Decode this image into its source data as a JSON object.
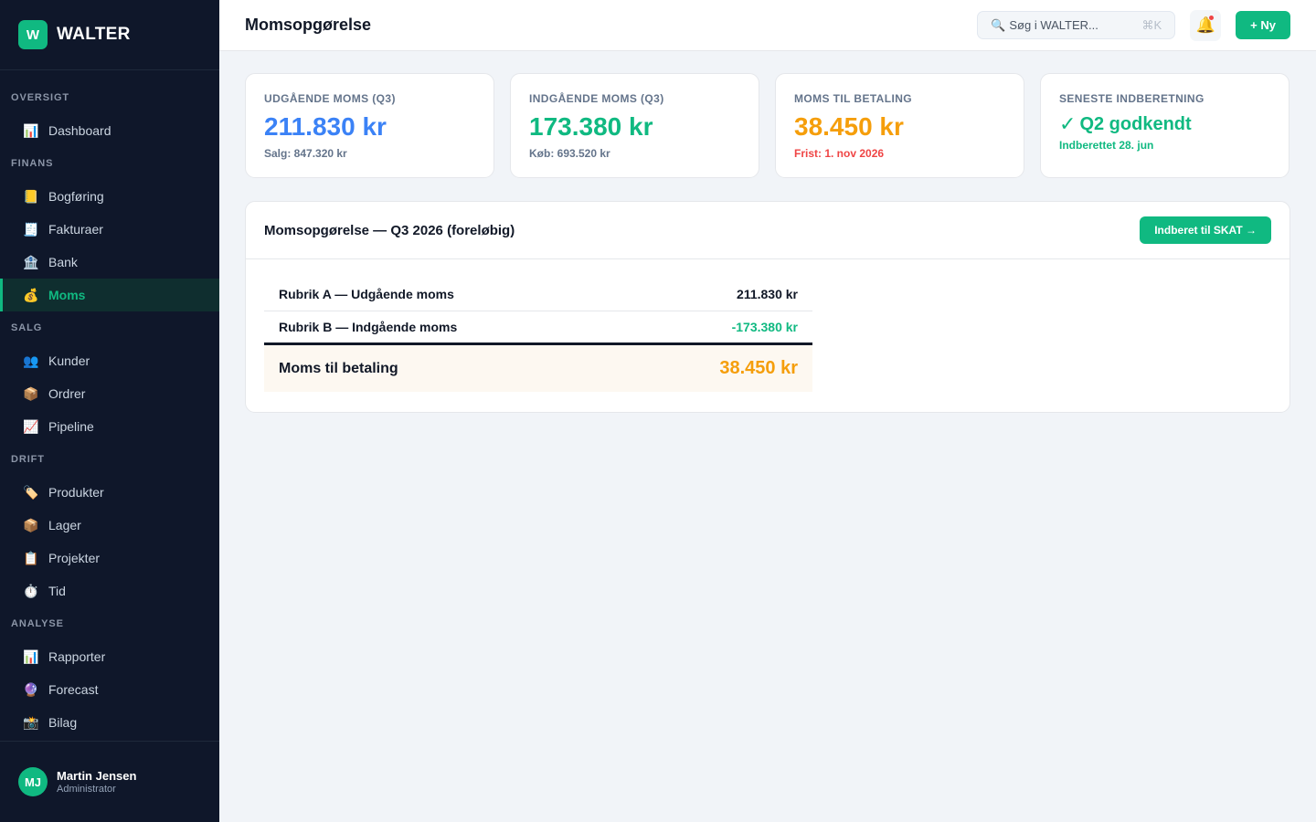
{
  "brand": {
    "logo_letter": "W",
    "name": "WALTER"
  },
  "sidebar": {
    "sections": [
      {
        "title": "OVERSIGT",
        "items": [
          {
            "label": "Dashboard",
            "icon": "📊",
            "icon_name": "chart-icon"
          }
        ]
      },
      {
        "title": "FINANS",
        "items": [
          {
            "label": "Bogføring",
            "icon": "📒",
            "icon_name": "ledger-icon"
          },
          {
            "label": "Fakturaer",
            "icon": "🧾",
            "icon_name": "receipt-icon"
          },
          {
            "label": "Bank",
            "icon": "🏦",
            "icon_name": "bank-icon"
          },
          {
            "label": "Moms",
            "icon": "💰",
            "icon_name": "money-bag-icon",
            "active": true
          }
        ]
      },
      {
        "title": "SALG",
        "items": [
          {
            "label": "Kunder",
            "icon": "👥",
            "icon_name": "people-icon"
          },
          {
            "label": "Ordrer",
            "icon": "📦",
            "icon_name": "package-icon"
          },
          {
            "label": "Pipeline",
            "icon": "📈",
            "icon_name": "trend-icon"
          }
        ]
      },
      {
        "title": "DRIFT",
        "items": [
          {
            "label": "Produkter",
            "icon": "🏷️",
            "icon_name": "tag-icon"
          },
          {
            "label": "Lager",
            "icon": "📦",
            "icon_name": "package-icon"
          },
          {
            "label": "Projekter",
            "icon": "📋",
            "icon_name": "clipboard-icon"
          },
          {
            "label": "Tid",
            "icon": "⏱️",
            "icon_name": "stopwatch-icon"
          }
        ]
      },
      {
        "title": "ANALYSE",
        "items": [
          {
            "label": "Rapporter",
            "icon": "📊",
            "icon_name": "chart-icon"
          },
          {
            "label": "Forecast",
            "icon": "🔮",
            "icon_name": "crystal-ball-icon"
          },
          {
            "label": "Bilag",
            "icon": "📸",
            "icon_name": "camera-icon"
          }
        ]
      }
    ],
    "user": {
      "initials": "MJ",
      "name": "Martin Jensen",
      "role": "Administrator"
    }
  },
  "header": {
    "title": "Momsopgørelse",
    "search": {
      "icon": "🔍",
      "placeholder": "Søg i WALTER...",
      "shortcut": "⌘K"
    },
    "bell_icon": "🔔",
    "new_button": "+ Ny"
  },
  "cards": {
    "output_vat": {
      "label": "UDGÅENDE MOMS (Q3)",
      "value": "211.830 kr",
      "sub": "Salg: 847.320 kr"
    },
    "input_vat": {
      "label": "INDGÅENDE MOMS (Q3)",
      "value": "173.380 kr",
      "sub": "Køb: 693.520 kr"
    },
    "vat_due": {
      "label": "MOMS TIL BETALING",
      "value": "38.450 kr",
      "sub": "Frist: 1. nov 2026"
    },
    "last_filing": {
      "label": "SENESTE INDBERETNING",
      "check": "✓",
      "status": "Q2 godkendt",
      "sub": "Indberettet 28. jun"
    }
  },
  "statement": {
    "title": "Momsopgørelse — Q3 2026 (foreløbig)",
    "report_button": "Indberet til SKAT →",
    "rows": [
      {
        "label": "Rubrik A — Udgående moms",
        "amount": "211.830 kr"
      },
      {
        "label": "Rubrik B — Indgående moms",
        "amount": "-173.380 kr"
      }
    ],
    "total": {
      "label": "Moms til betaling",
      "amount": "38.450 kr"
    }
  },
  "colors": {
    "accent": "#10b981",
    "sidebar_bg": "#0f172a",
    "blue": "#3b82f6",
    "amber": "#f59e0b",
    "red": "#ef4444"
  }
}
